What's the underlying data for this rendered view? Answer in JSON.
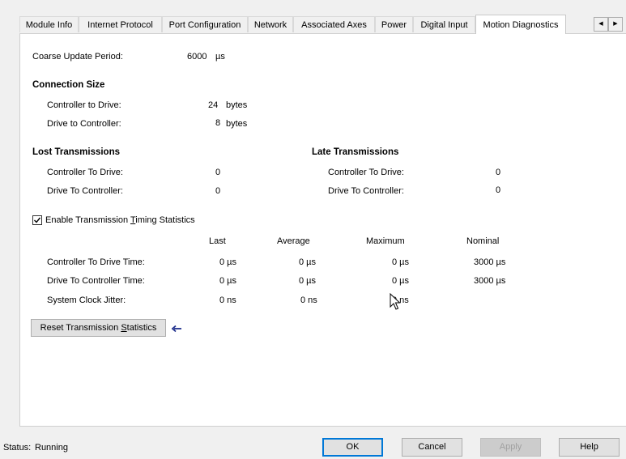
{
  "tabs": [
    {
      "label": "Module Info"
    },
    {
      "label": "Internet Protocol"
    },
    {
      "label": "Port Configuration"
    },
    {
      "label": "Network"
    },
    {
      "label": "Associated Axes"
    },
    {
      "label": "Power"
    },
    {
      "label": "Digital Input"
    },
    {
      "label": "Motion Diagnostics"
    }
  ],
  "coarse": {
    "label": "Coarse Update Period:",
    "value": "6000",
    "unit": "µs"
  },
  "connection": {
    "heading": "Connection Size",
    "c2d_label": "Controller to Drive:",
    "c2d_value": "24",
    "c2d_unit": "bytes",
    "d2c_label": "Drive to Controller:",
    "d2c_value": "8",
    "d2c_unit": "bytes"
  },
  "lost": {
    "heading": "Lost Transmissions",
    "c2d_label": "Controller To Drive:",
    "c2d_value": "0",
    "d2c_label": "Drive To Controller:",
    "d2c_value": "0"
  },
  "late": {
    "heading": "Late Transmissions",
    "c2d_label": "Controller To Drive:",
    "c2d_value": "0",
    "d2c_label": "Drive To Controller:",
    "d2c_value": "0"
  },
  "timing": {
    "checkbox_pre": "Enable Transmission ",
    "checkbox_ul": "T",
    "checkbox_post": "iming Statistics",
    "checked": true,
    "columns": {
      "last": "Last",
      "average": "Average",
      "maximum": "Maximum",
      "nominal": "Nominal"
    },
    "rows": [
      {
        "label": "Controller To Drive Time:",
        "last": "0 µs",
        "average": "0  µs",
        "maximum": "0  µs",
        "nominal": "3000  µs"
      },
      {
        "label": "Drive To Controller Time:",
        "last": "0 µs",
        "average": "0  µs",
        "maximum": "0  µs",
        "nominal": "3000  µs"
      },
      {
        "label": "System Clock Jitter:",
        "last": "0 ns",
        "average": "0 ns",
        "maximum": "0  ns",
        "nominal": ""
      }
    ]
  },
  "reset_button": {
    "pre": "Reset Transmission ",
    "ul": "S",
    "post": "tatistics"
  },
  "status": {
    "label": "Status:",
    "value": "Running"
  },
  "footer": {
    "ok": "OK",
    "cancel": "Cancel",
    "apply": "Apply",
    "help": "Help"
  },
  "colors": {
    "accent": "#0078d7",
    "arrow": "#1f2f8c"
  }
}
